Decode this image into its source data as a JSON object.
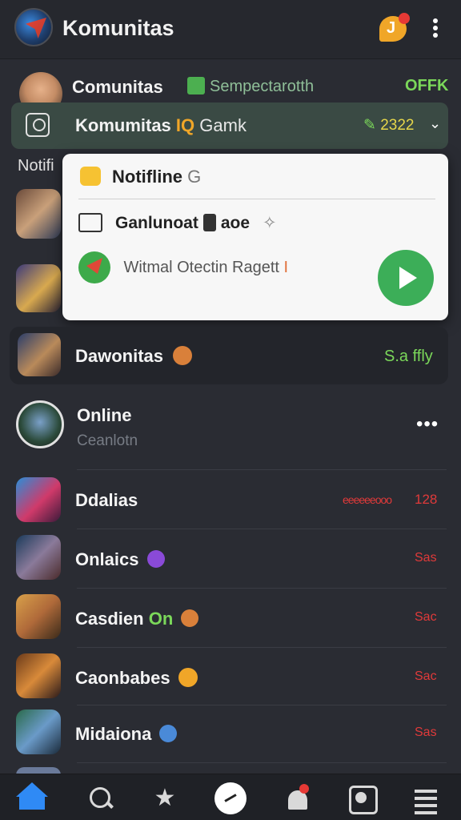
{
  "header": {
    "title": "Komunitas"
  },
  "top_row": {
    "name": "Comunitas",
    "sub": "Sempectarotth",
    "status": "OFFK"
  },
  "group_bar": {
    "name": "Komumitas",
    "marquee": "IQ",
    "suffix": "Gamk",
    "count": "2322"
  },
  "side_label": "Notifi",
  "popup": {
    "row1": {
      "label": "Notifline",
      "suffix": "G"
    },
    "row2": {
      "label": "Ganlunoat",
      "end": "aoe"
    },
    "row3": {
      "text": "Witmal Otectin Ragett",
      "mark": "I"
    }
  },
  "highlight": {
    "name": "Dawonitas",
    "status": "S.a ffly"
  },
  "online": {
    "name": "Online",
    "sub": "Ceanlotn"
  },
  "list": [
    {
      "name": "Ddalias",
      "status": "128",
      "ticker": "eeeeeeooo"
    },
    {
      "name": "Onlaics",
      "status": "Sas"
    },
    {
      "name": "Casdien",
      "tag": "On",
      "status": "Sac"
    },
    {
      "name": "Caonbabes",
      "status": "Sac"
    },
    {
      "name": "Midaiona",
      "status": "Sas"
    }
  ],
  "colors": {
    "accent_green": "#7bd85a",
    "accent_red": "#e03a3a",
    "accent_blue": "#2f8af5",
    "accent_orange": "#f0a628"
  },
  "icons": {
    "header": [
      "chat-bubble-icon",
      "more-vert-icon"
    ],
    "nav": [
      "home-icon",
      "search-icon",
      "star-icon",
      "compass-icon",
      "bell-icon",
      "square-icon",
      "menu-icon"
    ]
  }
}
